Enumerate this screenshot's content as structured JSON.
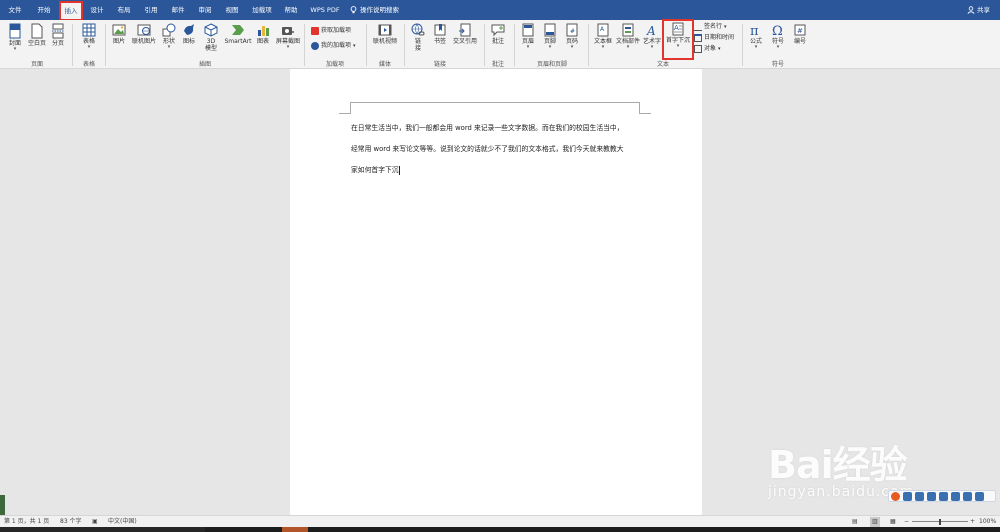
{
  "tabs": [
    {
      "label": "文件"
    },
    {
      "label": "开始"
    },
    {
      "label": "插入"
    },
    {
      "label": "设计"
    },
    {
      "label": "布局"
    },
    {
      "label": "引用"
    },
    {
      "label": "邮件"
    },
    {
      "label": "审阅"
    },
    {
      "label": "视图"
    },
    {
      "label": "加载项"
    },
    {
      "label": "帮助"
    },
    {
      "label": "WPS PDF"
    }
  ],
  "tell_me": "操作说明搜索",
  "share_label": "共享",
  "ribbon": {
    "pages": {
      "cover": "封面",
      "blank": "空白页",
      "break": "分页",
      "group": "页面"
    },
    "tables": {
      "table": "表格",
      "group": "表格"
    },
    "illustrations": {
      "picture": "图片",
      "online_picture": "联机图片",
      "shapes": "形状",
      "icons": "图标",
      "model3d": "3D 模型",
      "smartart": "SmartArt",
      "chart": "图表",
      "screenshot": "屏幕截图",
      "group": "插图"
    },
    "addins": {
      "get": "获取加载项",
      "my": "我的加载项",
      "group": "加载项"
    },
    "media": {
      "online_video": "联机视频",
      "group": "媒体"
    },
    "links": {
      "link": "链接",
      "bookmark": "书签",
      "cross_ref": "交叉引用",
      "group": "链接"
    },
    "comments": {
      "comment": "批注",
      "group": "批注"
    },
    "header_footer": {
      "header": "页眉",
      "footer": "页脚",
      "page_number": "页码",
      "group": "页眉和页脚"
    },
    "text": {
      "textbox": "文本框",
      "quick_parts": "文档部件",
      "wordart": "艺术字",
      "dropcap": "首字下沉",
      "signature": "签名行",
      "datetime": "日期和时间",
      "object": "对象",
      "group": "文本"
    },
    "symbols": {
      "equation": "公式",
      "symbol": "符号",
      "number": "编号",
      "group": "符号"
    }
  },
  "document": {
    "lines": [
      "在日常生活当中，我们一般都会用 word 来记录一些文字数据。而在我们的校园生活当中，",
      "经常用 word 来写论文等等。说到论文的话就少不了我们的文本格式，我们今天就来教教大",
      "家如何首字下沉"
    ]
  },
  "status": {
    "page": "第 1 页，共 1 页",
    "words": "83 个字",
    "language": "中文(中国)",
    "zoom": "100%"
  },
  "watermark": {
    "brand": "Bai经验",
    "url": "jingyan.baidu.com"
  },
  "colors": {
    "ribbon_blue": "#2b579a",
    "highlight": "#e0342c"
  }
}
